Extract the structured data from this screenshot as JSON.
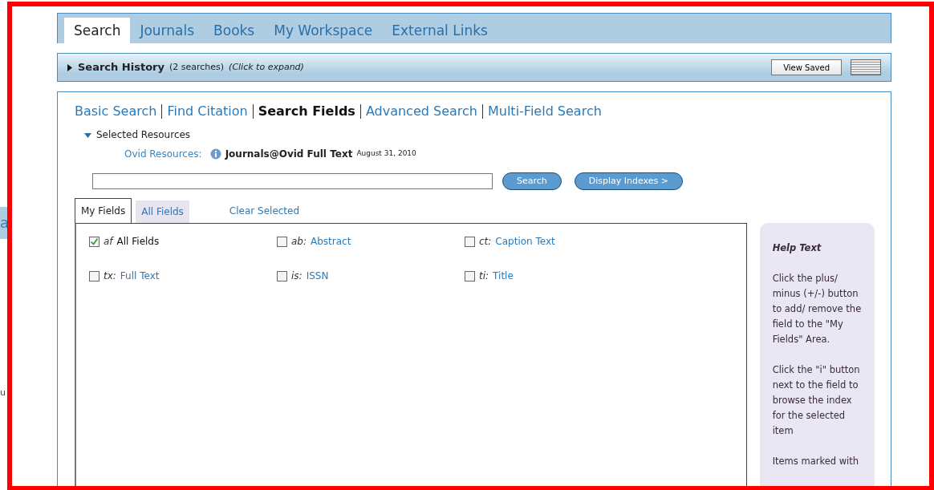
{
  "edge_fragment": {
    "texts": [
      "a",
      "u"
    ]
  },
  "tabs": [
    {
      "label": "Search",
      "selected": true
    },
    {
      "label": "Journals",
      "selected": false
    },
    {
      "label": "Books",
      "selected": false
    },
    {
      "label": "My Workspace",
      "selected": false
    },
    {
      "label": "External Links",
      "selected": false
    }
  ],
  "search_history": {
    "title": "Search History",
    "count": "(2 searches)",
    "hint": "(Click to expand)",
    "expanded": false,
    "view_saved": "View Saved"
  },
  "search_modes": [
    {
      "label": "Basic Search",
      "selected": false
    },
    {
      "label": "Find Citation",
      "selected": false
    },
    {
      "label": "Search Fields",
      "selected": true
    },
    {
      "label": "Advanced Search",
      "selected": false
    },
    {
      "label": "Multi-Field Search",
      "selected": false
    }
  ],
  "resources": {
    "heading": "Selected Resources",
    "expanded": true,
    "label": "Ovid Resources:",
    "name": "Journals@Ovid Full Text",
    "date": "August 31, 2010"
  },
  "search_button": "Search",
  "indexes_button": "Display Indexes >",
  "field_tabs": [
    {
      "label": "My Fields",
      "selected": true
    },
    {
      "label": "All Fields",
      "selected": false
    }
  ],
  "clear_selected": "Clear Selected",
  "fields": [
    {
      "code": "af",
      "name": "All Fields",
      "checked": true
    },
    {
      "code": "ab:",
      "name": "Abstract",
      "checked": false
    },
    {
      "code": "ct:",
      "name": "Caption Text",
      "checked": false
    },
    {
      "code": "tx:",
      "name": "Full Text",
      "checked": false
    },
    {
      "code": "is:",
      "name": "ISSN",
      "checked": false
    },
    {
      "code": "ti:",
      "name": "Title",
      "checked": false
    }
  ],
  "help": {
    "title": "Help Text",
    "paragraphs": [
      "Click the plus/ minus (+/-) button to add/ remove the field to the \"My Fields\" Area.",
      "Click the \"i\" button next to the field to browse the index for the selected item",
      "Items marked with"
    ]
  }
}
